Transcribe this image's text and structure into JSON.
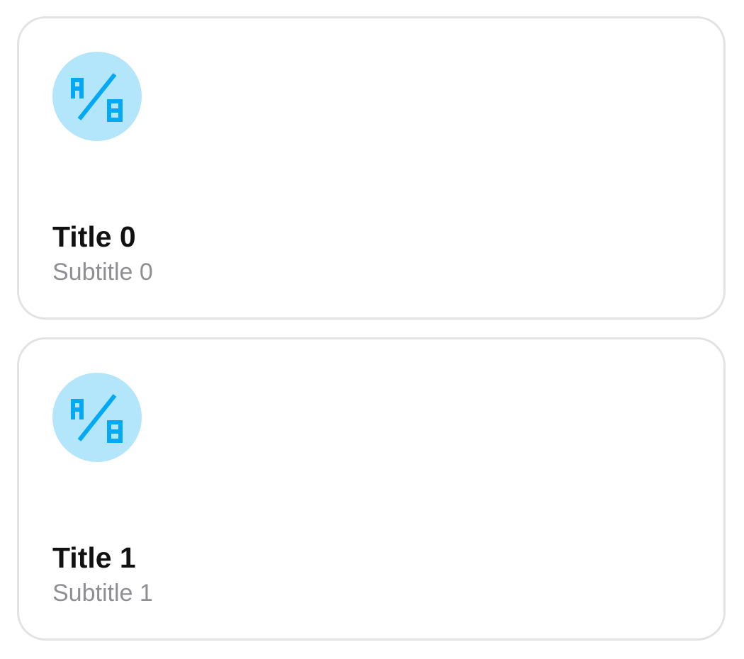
{
  "accent_color": "#03a9f4",
  "icon_bg_color": "#b3e5fb",
  "cards": [
    {
      "icon": "ab-test-icon",
      "title": "Title 0",
      "subtitle": "Subtitle 0"
    },
    {
      "icon": "ab-test-icon",
      "title": "Title 1",
      "subtitle": "Subtitle 1"
    }
  ]
}
